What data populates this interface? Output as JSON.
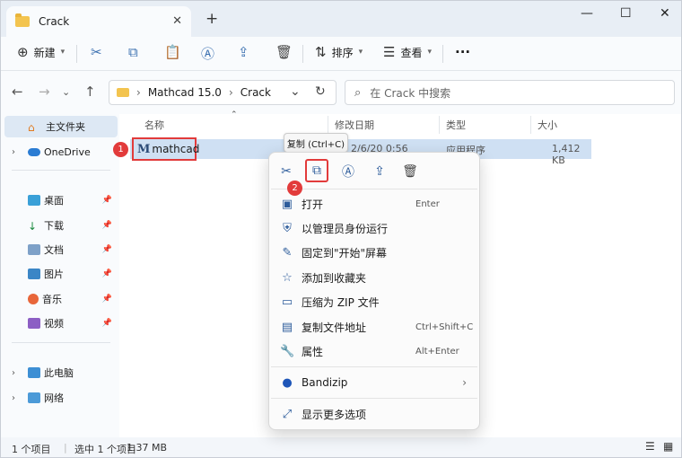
{
  "tab": {
    "title": "Crack",
    "close": "✕",
    "new": "+"
  },
  "window_controls": {
    "minimize": "—",
    "maximize": "☐",
    "close": "✕"
  },
  "toolbar": {
    "new_label": "新建",
    "sort_label": "排序",
    "view_label": "查看",
    "more": "···"
  },
  "address": {
    "path": [
      "Mathcad 15.0",
      "Crack"
    ]
  },
  "search": {
    "placeholder": "在 Crack 中搜索"
  },
  "sidebar": {
    "items": [
      {
        "label": "主文件夹"
      },
      {
        "label": "OneDrive"
      },
      {
        "label": "桌面"
      },
      {
        "label": "下载"
      },
      {
        "label": "文档"
      },
      {
        "label": "图片"
      },
      {
        "label": "音乐"
      },
      {
        "label": "视频"
      },
      {
        "label": "此电脑"
      },
      {
        "label": "网络"
      }
    ]
  },
  "columns": {
    "name": "名称",
    "modified": "修改日期",
    "type": "类型",
    "size": "大小"
  },
  "file": {
    "name": "mathcad",
    "modified": "2/6/20 0:56",
    "type": "应用程序",
    "size": "1,412 KB"
  },
  "badges": {
    "one": "1",
    "two": "2"
  },
  "tooltip": "复制 (Ctrl+C)",
  "context_menu": {
    "items": [
      {
        "label": "打开",
        "shortcut": "Enter"
      },
      {
        "label": "以管理员身份运行",
        "shortcut": ""
      },
      {
        "label": "固定到\"开始\"屏幕",
        "shortcut": ""
      },
      {
        "label": "添加到收藏夹",
        "shortcut": ""
      },
      {
        "label": "压缩为 ZIP 文件",
        "shortcut": ""
      },
      {
        "label": "复制文件地址",
        "shortcut": "Ctrl+Shift+C"
      },
      {
        "label": "属性",
        "shortcut": "Alt+Enter"
      },
      {
        "label": "Bandizip",
        "shortcut": ""
      },
      {
        "label": "显示更多选项",
        "shortcut": ""
      }
    ]
  },
  "status": {
    "count": "1 个项目",
    "selected": "选中 1 个项目",
    "size": "1.37 MB"
  },
  "colors": {
    "accent": "#3a6fb0",
    "highlight": "#e23b3b",
    "selection": "#cfe0f3"
  }
}
